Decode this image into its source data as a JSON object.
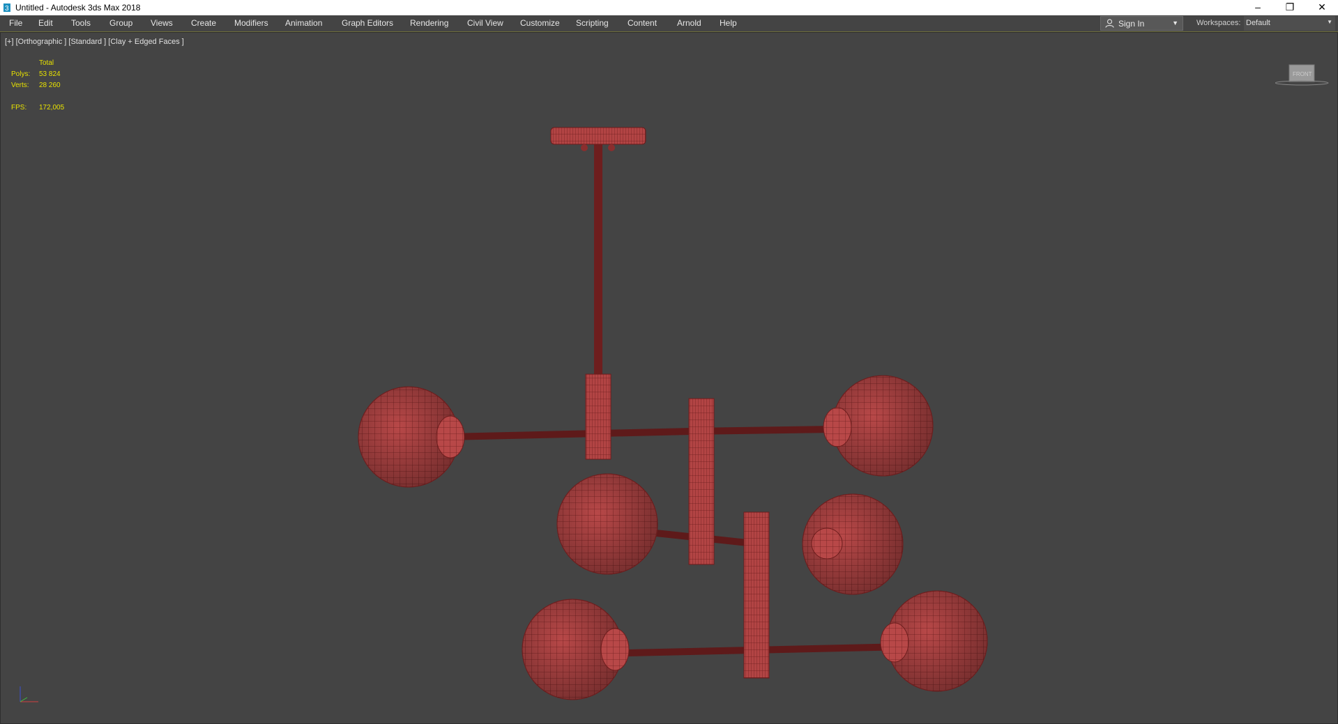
{
  "window": {
    "title": "Untitled - Autodesk 3ds Max 2018",
    "minimize": "–",
    "restore": "❐",
    "close": "✕"
  },
  "menu": {
    "items": [
      "File",
      "Edit",
      "Tools",
      "Group",
      "Views",
      "Create",
      "Modifiers",
      "Animation",
      "Graph Editors",
      "Rendering",
      "Civil View",
      "Customize",
      "Scripting",
      "Content",
      "Arnold",
      "Help"
    ]
  },
  "account": {
    "sign_in_label": "Sign In",
    "workspaces_label": "Workspaces:",
    "workspace_value": "Default"
  },
  "viewport": {
    "label": "[+] [Orthographic ] [Standard ] [Clay + Edged Faces ]",
    "stats": {
      "total_label": "Total",
      "polys_label": "Polys:",
      "polys_value": "53 824",
      "verts_label": "Verts:",
      "verts_value": "28 260",
      "fps_label": "FPS:",
      "fps_value": "172,005"
    },
    "viewcube_label": "FRONT"
  },
  "colors": {
    "accent_yellow": "#e8e200",
    "model_red": "#b84848",
    "viewport_bg": "#444444"
  },
  "icons": [
    "app-icon",
    "user-icon",
    "dropdown-arrow-icon",
    "minimize-icon",
    "restore-icon",
    "close-icon",
    "viewcube-icon",
    "axis-tripod-icon"
  ]
}
